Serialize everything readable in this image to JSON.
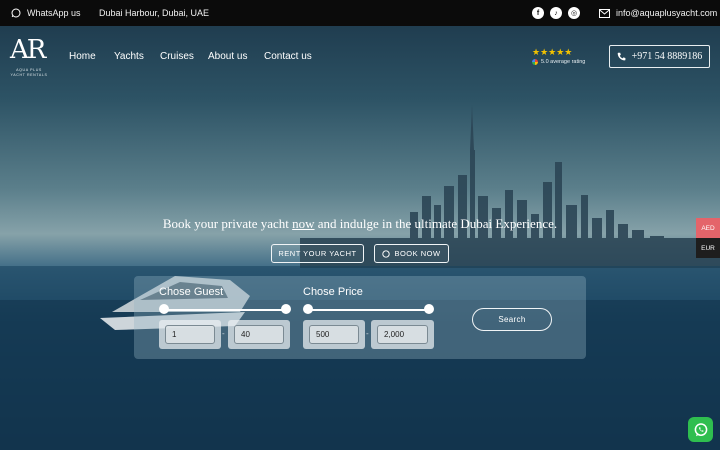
{
  "topbar": {
    "whatsapp_label": "WhatsApp us",
    "location": "Dubai Harbour, Dubai, UAE",
    "socials": [
      {
        "name": "facebook",
        "glyph": "f"
      },
      {
        "name": "tiktok",
        "glyph": "♪"
      },
      {
        "name": "instagram",
        "glyph": "◎"
      }
    ],
    "email": "info@aquaplusyacht.com"
  },
  "logo": {
    "mark": "AR",
    "tagline_1": "AQUA PLUS",
    "tagline_2": "YACHT RENTALS"
  },
  "nav": {
    "items": [
      "Home",
      "Yachts",
      "Cruises",
      "About us",
      "Contact us"
    ]
  },
  "rating": {
    "stars": "★★★★★",
    "text": "5.0 average rating",
    "value": 5
  },
  "phone": "+971 54 8889186",
  "hero": {
    "headline_before": "Book your private yacht ",
    "headline_emphasis": "now",
    "headline_after": " and indulge in the ultimate Dubai Experience.",
    "rent_button": "RENT YOUR YACHT",
    "book_button": "BOOK NOW"
  },
  "filters": {
    "guest_label": "Chose Guest",
    "price_label": "Chose Price",
    "guest_min": "1",
    "guest_max": "40",
    "price_min": "500",
    "price_max": "2,000",
    "search_label": "Search"
  },
  "currency": {
    "options": [
      "AED",
      "EUR"
    ],
    "selected": "AED"
  },
  "colors": {
    "topbar_bg": "#0b0b0b",
    "star": "#f2c200",
    "currency_active": "#e4646a",
    "whatsapp": "#2fbe4f"
  }
}
